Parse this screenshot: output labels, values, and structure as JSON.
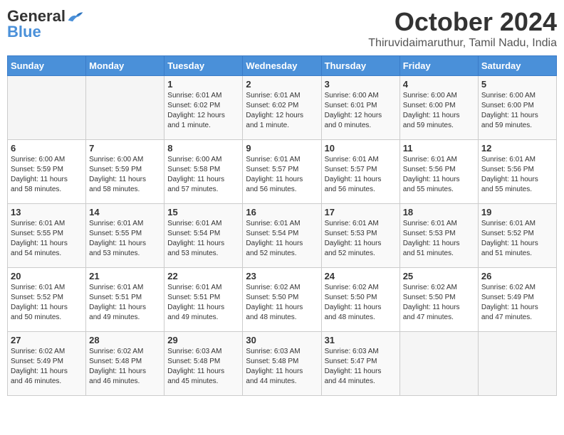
{
  "header": {
    "logo_general": "General",
    "logo_blue": "Blue",
    "month_title": "October 2024",
    "location": "Thiruvidaimaruthur, Tamil Nadu, India"
  },
  "weekdays": [
    "Sunday",
    "Monday",
    "Tuesday",
    "Wednesday",
    "Thursday",
    "Friday",
    "Saturday"
  ],
  "weeks": [
    [
      {
        "day": "",
        "text": ""
      },
      {
        "day": "",
        "text": ""
      },
      {
        "day": "1",
        "text": "Sunrise: 6:01 AM\nSunset: 6:02 PM\nDaylight: 12 hours\nand 1 minute."
      },
      {
        "day": "2",
        "text": "Sunrise: 6:01 AM\nSunset: 6:02 PM\nDaylight: 12 hours\nand 1 minute."
      },
      {
        "day": "3",
        "text": "Sunrise: 6:00 AM\nSunset: 6:01 PM\nDaylight: 12 hours\nand 0 minutes."
      },
      {
        "day": "4",
        "text": "Sunrise: 6:00 AM\nSunset: 6:00 PM\nDaylight: 11 hours\nand 59 minutes."
      },
      {
        "day": "5",
        "text": "Sunrise: 6:00 AM\nSunset: 6:00 PM\nDaylight: 11 hours\nand 59 minutes."
      }
    ],
    [
      {
        "day": "6",
        "text": "Sunrise: 6:00 AM\nSunset: 5:59 PM\nDaylight: 11 hours\nand 58 minutes."
      },
      {
        "day": "7",
        "text": "Sunrise: 6:00 AM\nSunset: 5:59 PM\nDaylight: 11 hours\nand 58 minutes."
      },
      {
        "day": "8",
        "text": "Sunrise: 6:00 AM\nSunset: 5:58 PM\nDaylight: 11 hours\nand 57 minutes."
      },
      {
        "day": "9",
        "text": "Sunrise: 6:01 AM\nSunset: 5:57 PM\nDaylight: 11 hours\nand 56 minutes."
      },
      {
        "day": "10",
        "text": "Sunrise: 6:01 AM\nSunset: 5:57 PM\nDaylight: 11 hours\nand 56 minutes."
      },
      {
        "day": "11",
        "text": "Sunrise: 6:01 AM\nSunset: 5:56 PM\nDaylight: 11 hours\nand 55 minutes."
      },
      {
        "day": "12",
        "text": "Sunrise: 6:01 AM\nSunset: 5:56 PM\nDaylight: 11 hours\nand 55 minutes."
      }
    ],
    [
      {
        "day": "13",
        "text": "Sunrise: 6:01 AM\nSunset: 5:55 PM\nDaylight: 11 hours\nand 54 minutes."
      },
      {
        "day": "14",
        "text": "Sunrise: 6:01 AM\nSunset: 5:55 PM\nDaylight: 11 hours\nand 53 minutes."
      },
      {
        "day": "15",
        "text": "Sunrise: 6:01 AM\nSunset: 5:54 PM\nDaylight: 11 hours\nand 53 minutes."
      },
      {
        "day": "16",
        "text": "Sunrise: 6:01 AM\nSunset: 5:54 PM\nDaylight: 11 hours\nand 52 minutes."
      },
      {
        "day": "17",
        "text": "Sunrise: 6:01 AM\nSunset: 5:53 PM\nDaylight: 11 hours\nand 52 minutes."
      },
      {
        "day": "18",
        "text": "Sunrise: 6:01 AM\nSunset: 5:53 PM\nDaylight: 11 hours\nand 51 minutes."
      },
      {
        "day": "19",
        "text": "Sunrise: 6:01 AM\nSunset: 5:52 PM\nDaylight: 11 hours\nand 51 minutes."
      }
    ],
    [
      {
        "day": "20",
        "text": "Sunrise: 6:01 AM\nSunset: 5:52 PM\nDaylight: 11 hours\nand 50 minutes."
      },
      {
        "day": "21",
        "text": "Sunrise: 6:01 AM\nSunset: 5:51 PM\nDaylight: 11 hours\nand 49 minutes."
      },
      {
        "day": "22",
        "text": "Sunrise: 6:01 AM\nSunset: 5:51 PM\nDaylight: 11 hours\nand 49 minutes."
      },
      {
        "day": "23",
        "text": "Sunrise: 6:02 AM\nSunset: 5:50 PM\nDaylight: 11 hours\nand 48 minutes."
      },
      {
        "day": "24",
        "text": "Sunrise: 6:02 AM\nSunset: 5:50 PM\nDaylight: 11 hours\nand 48 minutes."
      },
      {
        "day": "25",
        "text": "Sunrise: 6:02 AM\nSunset: 5:50 PM\nDaylight: 11 hours\nand 47 minutes."
      },
      {
        "day": "26",
        "text": "Sunrise: 6:02 AM\nSunset: 5:49 PM\nDaylight: 11 hours\nand 47 minutes."
      }
    ],
    [
      {
        "day": "27",
        "text": "Sunrise: 6:02 AM\nSunset: 5:49 PM\nDaylight: 11 hours\nand 46 minutes."
      },
      {
        "day": "28",
        "text": "Sunrise: 6:02 AM\nSunset: 5:48 PM\nDaylight: 11 hours\nand 46 minutes."
      },
      {
        "day": "29",
        "text": "Sunrise: 6:03 AM\nSunset: 5:48 PM\nDaylight: 11 hours\nand 45 minutes."
      },
      {
        "day": "30",
        "text": "Sunrise: 6:03 AM\nSunset: 5:48 PM\nDaylight: 11 hours\nand 44 minutes."
      },
      {
        "day": "31",
        "text": "Sunrise: 6:03 AM\nSunset: 5:47 PM\nDaylight: 11 hours\nand 44 minutes."
      },
      {
        "day": "",
        "text": ""
      },
      {
        "day": "",
        "text": ""
      }
    ]
  ]
}
